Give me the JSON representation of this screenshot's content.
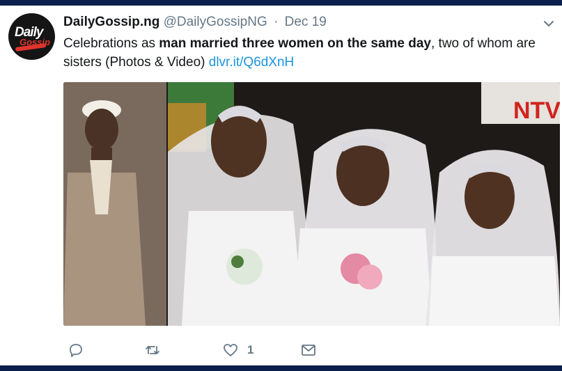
{
  "tweet": {
    "display_name": "DailyGossip.ng",
    "handle": "@DailyGossipNG",
    "separator": "·",
    "date": "Dec 19",
    "text_before": "Celebrations as ",
    "text_bold": "man married three women on the same day",
    "text_after": ", two of whom are sisters (Photos & Video) ",
    "link": "dlvr.it/Q6dXnH"
  },
  "avatar": {
    "logo_line1": "Daily",
    "logo_line2": "Gossip",
    "brand_red": "#e0342c"
  },
  "media": {
    "watermark": "NTV",
    "watermark_color": "#d0241d"
  },
  "actions": {
    "reply_icon": "reply-icon",
    "retweet_icon": "retweet-icon",
    "like_icon": "heart-icon",
    "like_count": "1",
    "dm_icon": "envelope-icon"
  },
  "colors": {
    "text": "#14171a",
    "secondary": "#657786",
    "link": "#1b95e0",
    "frame": "#0b1f4d"
  }
}
